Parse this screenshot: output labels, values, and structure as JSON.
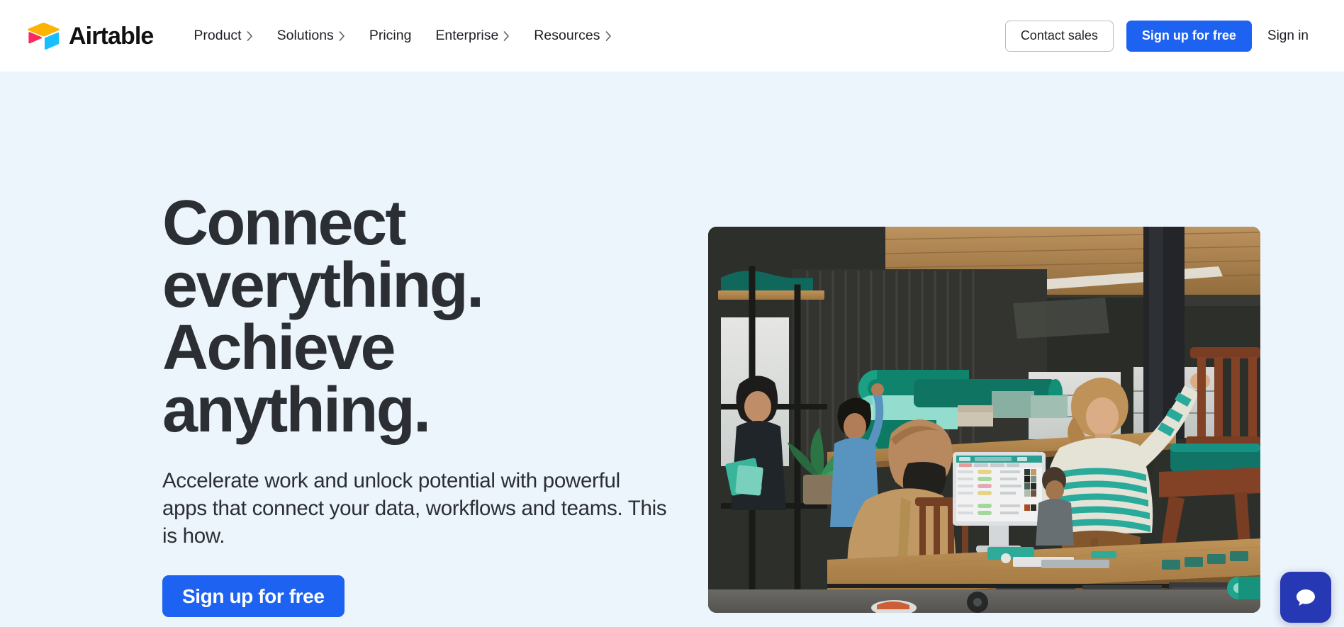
{
  "header": {
    "brand": {
      "name": "Airtable",
      "logo_icon": "airtable-cube-logo"
    },
    "nav": [
      {
        "label": "Product",
        "has_chevron": true
      },
      {
        "label": "Solutions",
        "has_chevron": true
      },
      {
        "label": "Pricing",
        "has_chevron": false
      },
      {
        "label": "Enterprise",
        "has_chevron": true
      },
      {
        "label": "Resources",
        "has_chevron": true
      }
    ],
    "actions": {
      "contact_sales": "Contact sales",
      "sign_up": "Sign up for free",
      "sign_in": "Sign in"
    }
  },
  "hero": {
    "title_line1": "Connect",
    "title_line2": "everything.",
    "title_line3": "Achieve",
    "title_line4": "anything.",
    "subtitle": "Accelerate work and unlock potential with powerful apps that connect your data, workflows and teams. This is how.",
    "cta": "Sign up for free",
    "image_alt": "Two people in an industrial furniture workshop reviewing an Airtable grid on a desktop monitor, surrounded by teal fabric rolls and wooden chairs"
  },
  "chat": {
    "icon": "speech-bubble-icon",
    "label": "Open chat"
  },
  "colors": {
    "page_background": "#ecf4fc",
    "header_background": "#ffffff",
    "primary_blue": "#1d62f0",
    "text_dark": "#2b2f33",
    "chat_blue": "#2738b4",
    "logo_yellow": "#fcb400",
    "logo_pink": "#f82b60",
    "logo_blue": "#18bfff"
  }
}
